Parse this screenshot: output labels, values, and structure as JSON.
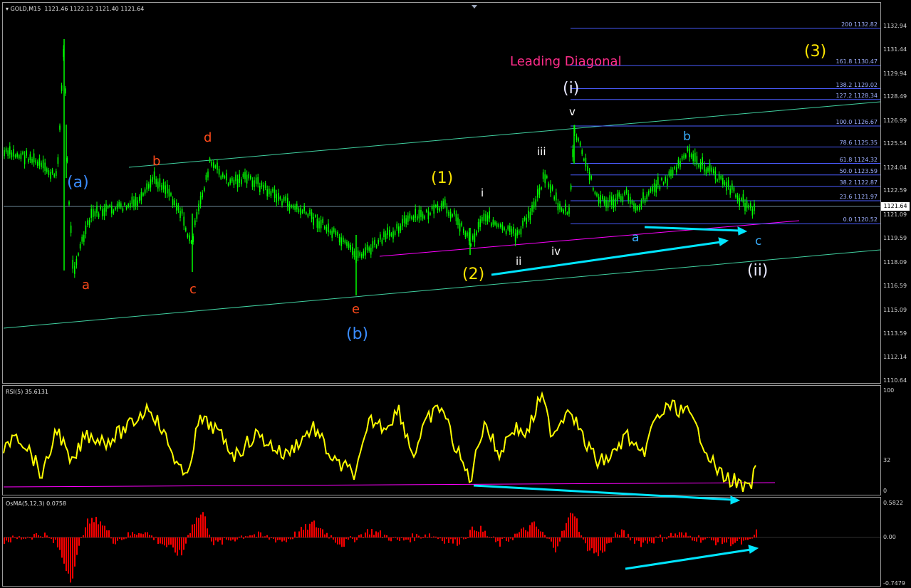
{
  "chart": {
    "symbol_header": "GOLD,M15",
    "ohlc": "1121.46 1122.12 1121.40 1121.64",
    "current_price": "1121.64",
    "price_scale": [
      "1132.94",
      "1131.44",
      "1129.94",
      "1128.49",
      "1126.99",
      "1125.54",
      "1124.04",
      "1122.59",
      "1121.09",
      "1119.59",
      "1118.09",
      "1116.59",
      "1115.09",
      "1113.59",
      "1112.14",
      "1110.64"
    ],
    "title_annotation": "Leading Diagonal",
    "fib_levels": [
      {
        "ratio": "200",
        "price": "1132.82"
      },
      {
        "ratio": "161.8",
        "price": "1130.47"
      },
      {
        "ratio": "138.2",
        "price": "1129.02"
      },
      {
        "ratio": "127.2",
        "price": "1128.34"
      },
      {
        "ratio": "100.0",
        "price": "1126.67"
      },
      {
        "ratio": "78.6",
        "price": "1125.35"
      },
      {
        "ratio": "61.8",
        "price": "1124.32"
      },
      {
        "ratio": "50.0",
        "price": "1123.59"
      },
      {
        "ratio": "38.2",
        "price": "1122.87"
      },
      {
        "ratio": "23.6",
        "price": "1121.97"
      },
      {
        "ratio": "0.0",
        "price": "1120.52"
      }
    ],
    "wave_labels": {
      "a_blue": "(a)",
      "b_blue": "(b)",
      "a_orange": "a",
      "b_orange": "b",
      "c_orange": "c",
      "d_orange": "d",
      "e_orange": "e",
      "w1": "(1)",
      "w2": "(2)",
      "w3": "(3)",
      "i_paren": "(i)",
      "ii_paren": "(ii)",
      "i": "i",
      "ii": "ii",
      "iii": "iii",
      "iv": "iv",
      "v": "v",
      "a_cyan": "a",
      "b_cyan": "b",
      "c_cyan": "c"
    }
  },
  "rsi": {
    "header": "RSI(5) 35.6131",
    "scale": [
      "100",
      "32",
      "0"
    ]
  },
  "osma": {
    "header": "OsMA(5,12,3) 0.0758",
    "scale": [
      "0.5822",
      "0.00",
      "-0.7479"
    ]
  },
  "colors": {
    "candles": "#00ff00",
    "rsi_line": "#ffff00",
    "osma_bars": "#ff0000",
    "channel": "#40d0a0",
    "fib": "#4a5cff",
    "magenta": "#ff00ff",
    "cyan_arrow": "#00e5ff"
  }
}
